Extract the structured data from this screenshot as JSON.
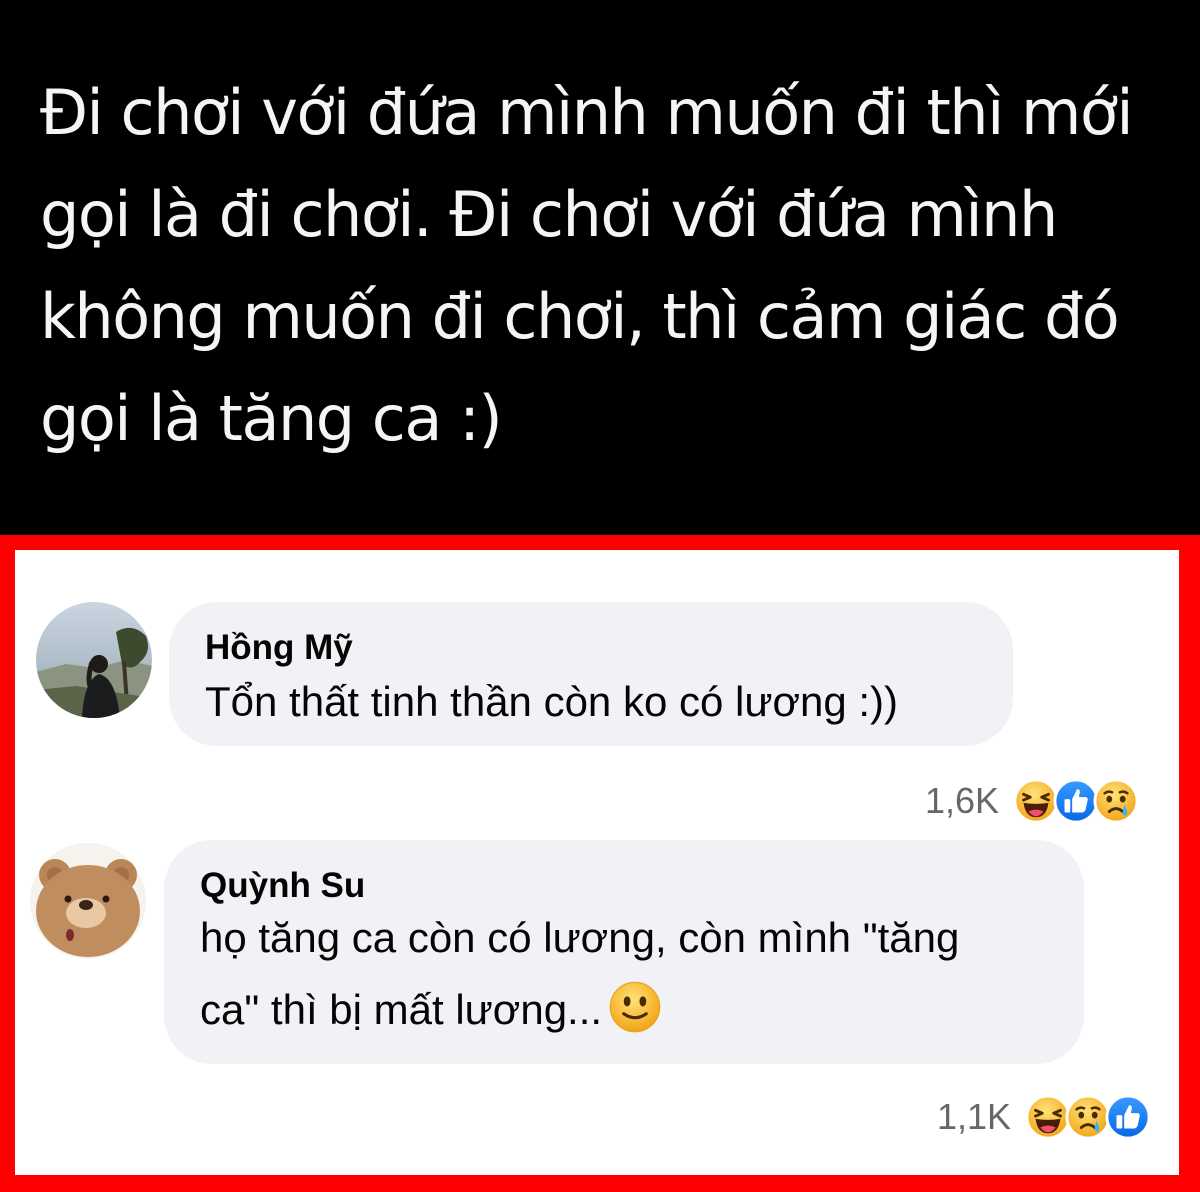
{
  "post": {
    "text": "Đi chơi với đứa mình muốn đi thì mới\ngọi là đi chơi. Đi chơi với đứa mình\nkhông muốn đi chơi, thì cảm giác đó\ngọi là tăng ca :)"
  },
  "comments": [
    {
      "author": "Hồng Mỹ",
      "text": "Tổn thất tinh thần còn ko có lương :))",
      "reaction_count": "1,6K",
      "reactions": [
        "haha-icon",
        "like-icon",
        "sad-icon"
      ]
    },
    {
      "author": "Quỳnh Su",
      "text_line1": "họ tăng ca còn có lương, còn mình \"tăng",
      "text_line2": "ca\" thì bị mất lương...",
      "inline_emoji": "slightly-smiling-icon",
      "reaction_count": "1,1K",
      "reactions": [
        "haha-icon",
        "sad-icon",
        "like-icon"
      ]
    }
  ],
  "colors": {
    "post_background": "#000000",
    "highlight_border": "#ff0000",
    "bubble": "#f0f2f5",
    "like_blue": "#1877f2",
    "emoji_yellow": "#f7b928"
  }
}
